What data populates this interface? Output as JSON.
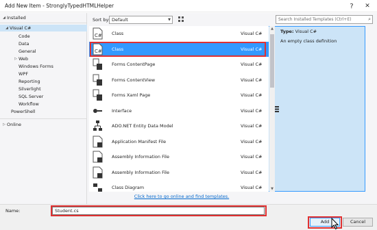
{
  "window": {
    "title": "Add New Item - StronglyTypedHTMLHelper",
    "help": "?",
    "close": "✕"
  },
  "tree": {
    "installed": "Installed",
    "visual_csharp": "Visual C#",
    "children": [
      "Code",
      "Data",
      "General",
      "Web",
      "Windows Forms",
      "WPF",
      "Reporting",
      "Silverlight",
      "SQL Server",
      "Workflow"
    ],
    "powershell": "PowerShell",
    "online": "Online"
  },
  "toolbar": {
    "sort_label": "Sort by:",
    "sort_value": "Default",
    "search_placeholder": "Search Installed Templates (Ctrl+E)"
  },
  "templates": [
    {
      "name": "Class",
      "lang": "Visual C#",
      "icon": "class-icon"
    },
    {
      "name": "Class",
      "lang": "Visual C#",
      "icon": "class-icon"
    },
    {
      "name": "Forms ContentPage",
      "lang": "Visual C#",
      "icon": "forms-page-icon"
    },
    {
      "name": "Forms ContentView",
      "lang": "Visual C#",
      "icon": "forms-view-icon"
    },
    {
      "name": "Forms Xaml Page",
      "lang": "Visual C#",
      "icon": "xaml-page-icon"
    },
    {
      "name": "Interface",
      "lang": "Visual C#",
      "icon": "interface-icon"
    },
    {
      "name": "ADO.NET Entity Data Model",
      "lang": "Visual C#",
      "icon": "entity-model-icon"
    },
    {
      "name": "Application Manifest File",
      "lang": "Visual C#",
      "icon": "manifest-icon"
    },
    {
      "name": "Assembly Information File",
      "lang": "Visual C#",
      "icon": "assembly-info-icon"
    },
    {
      "name": "Assembly Information File",
      "lang": "Visual C#",
      "icon": "assembly-info-icon"
    },
    {
      "name": "Class Diagram",
      "lang": "Visual C#",
      "icon": "class-diagram-icon"
    }
  ],
  "selected_template_index": 1,
  "online_link": "Click here to go online and find templates.",
  "details": {
    "type_label": "Type:",
    "type_value": "Visual C#",
    "description": "An empty class definition"
  },
  "name_field": {
    "label": "Name:",
    "value": "Student.cs"
  },
  "buttons": {
    "add": "Add",
    "cancel": "Cancel"
  },
  "colors": {
    "selection": "#3399ff",
    "highlight_box": "#e03030",
    "link": "#0066cc"
  }
}
